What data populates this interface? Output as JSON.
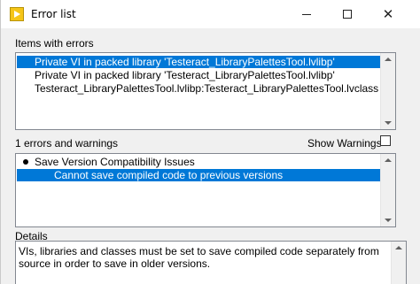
{
  "window": {
    "title": "Error list",
    "controls": {
      "minimize": "minimize",
      "maximize": "maximize",
      "close": "close"
    }
  },
  "items_with_errors": {
    "label": "Items with errors",
    "rows": [
      "Private VI in packed library 'Testeract_LibraryPalettesTool.lvlibp'",
      "Private VI in packed library 'Testeract_LibraryPalettesTool.lvlibp'",
      "Testeract_LibraryPalettesTool.lvlibp:Testeract_LibraryPalettesTool.lvclass"
    ],
    "selected_index": 0
  },
  "errors_warnings": {
    "label": "1 errors and warnings",
    "show_warnings_label": "Show Warnings",
    "show_warnings_checked": false,
    "rows": [
      {
        "text": "Save Version Compatibility Issues",
        "bullet": true
      },
      {
        "text": "Cannot save compiled code to previous versions",
        "bullet": false,
        "selected": true
      }
    ]
  },
  "details": {
    "label": "Details",
    "text": "VIs, libraries and classes must be set to save compiled code separately from source in order to save in older versions."
  },
  "colors": {
    "selection": "#0078d7",
    "window_bg": "#f0f0f0"
  }
}
